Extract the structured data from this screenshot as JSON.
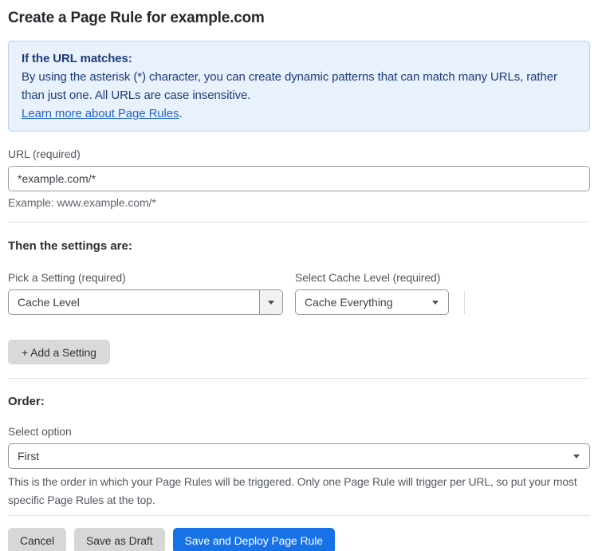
{
  "page": {
    "title": "Create a Page Rule for example.com"
  },
  "info_box": {
    "heading": "If the URL matches:",
    "body": "By using the asterisk (*) character, you can create dynamic patterns that can match many URLs, rather than just one. All URLs are case insensitive.",
    "link_label": "Learn more about Page Rules",
    "link_suffix": "."
  },
  "url_field": {
    "label": "URL (required)",
    "value": "*example.com/*",
    "help": "Example: www.example.com/*"
  },
  "settings_section": {
    "heading": "Then the settings are:",
    "setting_picker": {
      "label": "Pick a Setting (required)",
      "value": "Cache Level"
    },
    "cache_level_picker": {
      "label": "Select Cache Level (required)",
      "value": "Cache Everything"
    },
    "add_setting_label": "+ Add a Setting"
  },
  "order_section": {
    "heading": "Order:",
    "label": "Select option",
    "value": "First",
    "help": "This is the order in which your Page Rules will be triggered. Only one Page Rule will trigger per URL, so put your most specific Page Rules at the top."
  },
  "actions": {
    "cancel_label": "Cancel",
    "save_draft_label": "Save as Draft",
    "save_deploy_label": "Save and Deploy Page Rule"
  },
  "icons": {
    "dropdown_caret": "caret-down"
  },
  "colors": {
    "accent_blue": "#1672e6",
    "info_bg": "#e8f1fc",
    "info_border": "#b9d1f1",
    "info_text": "#1f3d78",
    "link_blue": "#2465cf",
    "button_gray": "#d7d7d7"
  }
}
